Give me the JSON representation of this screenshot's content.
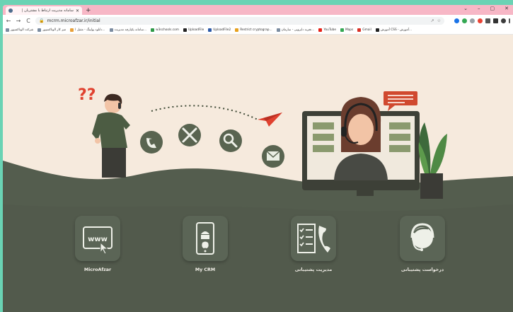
{
  "browser": {
    "tab_title": "سامانه مدیریت ارتباط با مشتریان |",
    "tab_close": "✕",
    "new_tab": "+",
    "window_controls": [
      "⌄",
      "–",
      "▢",
      "✕"
    ],
    "nav": {
      "back": "←",
      "forward": "→",
      "reload": "C"
    },
    "url": "mcrm.microafzar.ir/initial",
    "lock_icon": "lock-icon"
  },
  "bookmarks": [
    "شرکت الوتاکسپور",
    "میز کار الوتاکسپور",
    "دانلود پولینگ - مقبل ا...",
    "سامانه یکپارچه مدیریت...",
    "w3schools.com",
    "UploadFile",
    "UploadFile2",
    "Restrict cryptograp...",
    "تجربه دایرویی - سازمان...",
    "YouTube",
    "Maps",
    "Gmail",
    "آموزش CSS - آموزش..."
  ],
  "apps": [
    {
      "label": "MicroAfzar",
      "icon": "www-click-icon"
    },
    {
      "label": "My CRM",
      "icon": "mobile-android-apple-icon"
    },
    {
      "label": "مدیریت پشتیبانی",
      "icon": "checklist-phone-icon"
    },
    {
      "label": "درخواست پشتیبانی",
      "icon": "headset-user-icon"
    }
  ],
  "colors": {
    "background": "#f6eadd",
    "hills": "#545d4e",
    "card": "#5b6556",
    "accent_tab": "#f7b7c6",
    "frame": "#6ad3b4"
  }
}
